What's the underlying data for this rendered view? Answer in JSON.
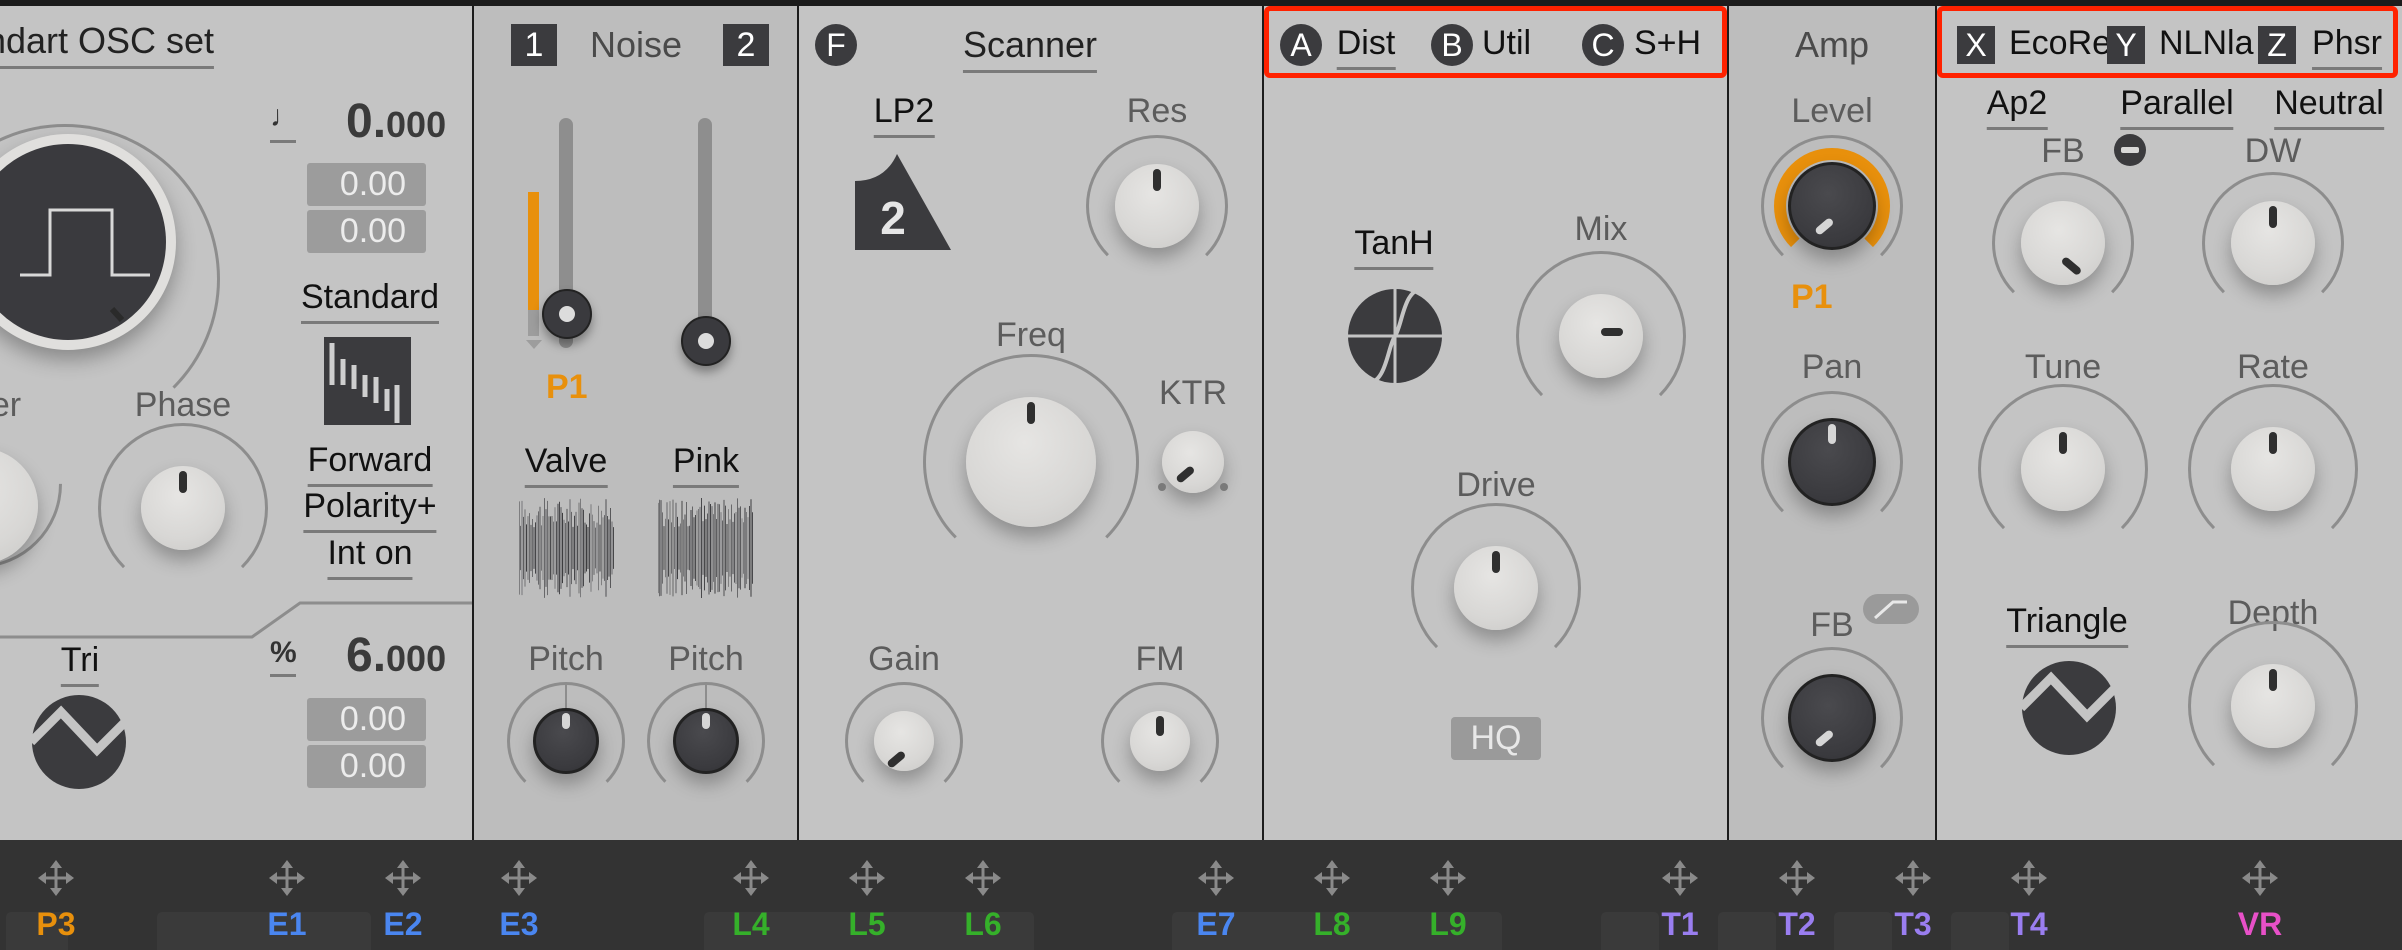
{
  "osc": {
    "preset_title": "ndart OSC set",
    "wave_shape": "square",
    "tempo_icon": "quarter-note-icon",
    "value_main": "0.",
    "value_main_decimals": "000",
    "value_box_1": "0.00",
    "value_box_2": "0.00",
    "standard_label": "Standard",
    "forward_label": "Forward",
    "polarity_label": "Polarity+",
    "int_label": "Int on",
    "knob_left_label_partial": "er",
    "phase_label": "Phase",
    "tri_label": "Tri",
    "percent_icon": "percent-icon",
    "value2_main": "6.",
    "value2_main_decimals": "000",
    "value2_box_1": "0.00",
    "value2_box_2": "0.00",
    "phase_value": 0.5,
    "wave_knob_value": 0.85
  },
  "noise": {
    "title": "Noise",
    "badge_1": "1",
    "badge_2": "2",
    "slider_1_value": 0.15,
    "slider_2_value": 0.1,
    "slider_1_mod_depth": 0.55,
    "mod_source_label": "P1",
    "noise_1_type": "Valve",
    "noise_2_type": "Pink",
    "pitch_1_label": "Pitch",
    "pitch_2_label": "Pitch",
    "pitch_1_value": 0.5,
    "pitch_2_value": 0.5
  },
  "scanner": {
    "badge": "F",
    "title": "Scanner",
    "filter_type": "LP2",
    "filter_icon_number": "2",
    "res_label": "Res",
    "freq_label": "Freq",
    "ktr_label": "KTR",
    "gain_label": "Gain",
    "fm_label": "FM",
    "res_value": 0.5,
    "freq_value": 0.5,
    "ktr_value": 0.15,
    "gain_value": 0.2,
    "fm_value": 0.5
  },
  "fx_abc": {
    "tabs": [
      {
        "badge": "A",
        "label": "Dist",
        "active": true
      },
      {
        "badge": "B",
        "label": "Util",
        "active": false
      },
      {
        "badge": "C",
        "label": "S+H",
        "active": false
      }
    ],
    "mode_label": "TanH",
    "mix_label": "Mix",
    "drive_label": "Drive",
    "hq_label": "HQ",
    "mix_value": 0.75,
    "drive_value": 0.5
  },
  "amp": {
    "title": "Amp",
    "level_label": "Level",
    "level_mod_label": "P1",
    "pan_label": "Pan",
    "fb_label": "FB",
    "level_value": 0.2,
    "pan_value": 0.5,
    "fb_value": 0.2
  },
  "fx_xyz": {
    "tabs": [
      {
        "badge": "X",
        "label": "EcoRe",
        "active": false
      },
      {
        "badge": "Y",
        "label": "NLNla",
        "active": false
      },
      {
        "badge": "Z",
        "label": "Phsr",
        "active": true
      }
    ],
    "ap_label": "Ap2",
    "parallel_label": "Parallel",
    "neutral_label": "Neutral",
    "fb_label": "FB",
    "dw_label": "DW",
    "tune_label": "Tune",
    "rate_label": "Rate",
    "lfo_shape_label": "Triangle",
    "depth_label": "Depth",
    "fb_value": 0.8,
    "dw_value": 0.5,
    "tune_value": 0.5,
    "rate_value": 0.5,
    "depth_value": 0.5
  },
  "mod_bar": {
    "slots": [
      {
        "label": "P3",
        "color": "#e8900c"
      },
      {
        "label": "E1",
        "color": "#4a86f0"
      },
      {
        "label": "E2",
        "color": "#4a86f0"
      },
      {
        "label": "E3",
        "color": "#4a86f0"
      },
      {
        "label": "L4",
        "color": "#35b02a"
      },
      {
        "label": "L5",
        "color": "#35b02a"
      },
      {
        "label": "L6",
        "color": "#35b02a"
      },
      {
        "label": "E7",
        "color": "#4a86f0"
      },
      {
        "label": "L8",
        "color": "#35b02a"
      },
      {
        "label": "L9",
        "color": "#35b02a"
      },
      {
        "label": "T1",
        "color": "#9a7ef0"
      },
      {
        "label": "T2",
        "color": "#9a7ef0"
      },
      {
        "label": "T3",
        "color": "#9a7ef0"
      },
      {
        "label": "T4",
        "color": "#9a7ef0"
      },
      {
        "label": "VR",
        "color": "#e850c8"
      }
    ]
  },
  "colors": {
    "accent_orange": "#e8900c",
    "highlight_red": "#ff2200",
    "panel_bg": "#c4c4c4",
    "bar_bg": "#333333"
  }
}
